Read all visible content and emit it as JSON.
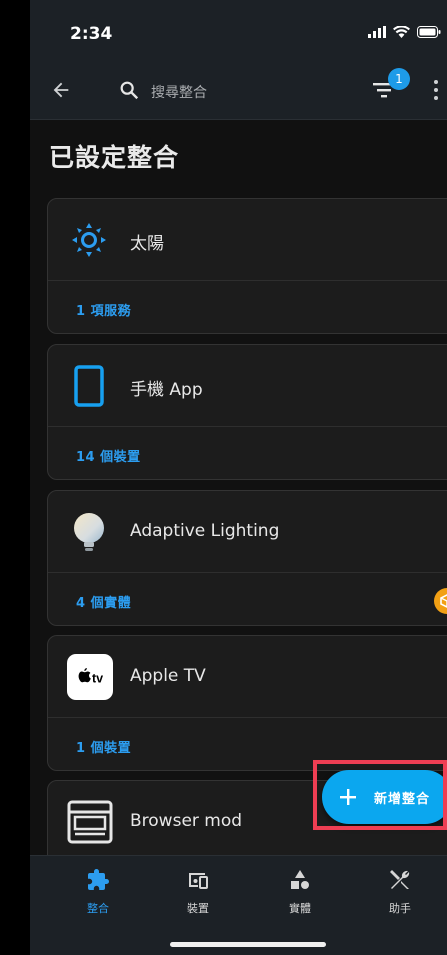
{
  "status_bar": {
    "time": "2:34"
  },
  "toolbar": {
    "search_placeholder": "搜尋整合",
    "filter_badge": "1"
  },
  "page": {
    "title": "已設定整合"
  },
  "integrations": [
    {
      "name": "太陽",
      "link": "1 項服務",
      "icon": "sun-icon"
    },
    {
      "name": "手機 App",
      "link": "14 個裝置",
      "icon": "phone-icon"
    },
    {
      "name": "Adaptive Lighting",
      "link": "4 個實體",
      "icon": "bulb-icon",
      "extra_icon": "custom-integration-icon"
    },
    {
      "name": "Apple TV",
      "link": "1 個裝置",
      "icon": "apple-tv-icon"
    },
    {
      "name": "Browser mod",
      "link": "",
      "icon": "browser-icon"
    }
  ],
  "fab": {
    "label": "新增整合"
  },
  "bottom_nav": [
    {
      "label": "整合",
      "icon": "puzzle-icon",
      "active": true
    },
    {
      "label": "裝置",
      "icon": "devices-icon",
      "active": false
    },
    {
      "label": "實體",
      "icon": "shapes-icon",
      "active": false
    },
    {
      "label": "助手",
      "icon": "tools-icon",
      "active": false
    }
  ],
  "colors": {
    "accent": "#2c9df0",
    "fab": "#0ba7ef",
    "highlight": "#ee3e53",
    "badge": "#f2a014"
  }
}
